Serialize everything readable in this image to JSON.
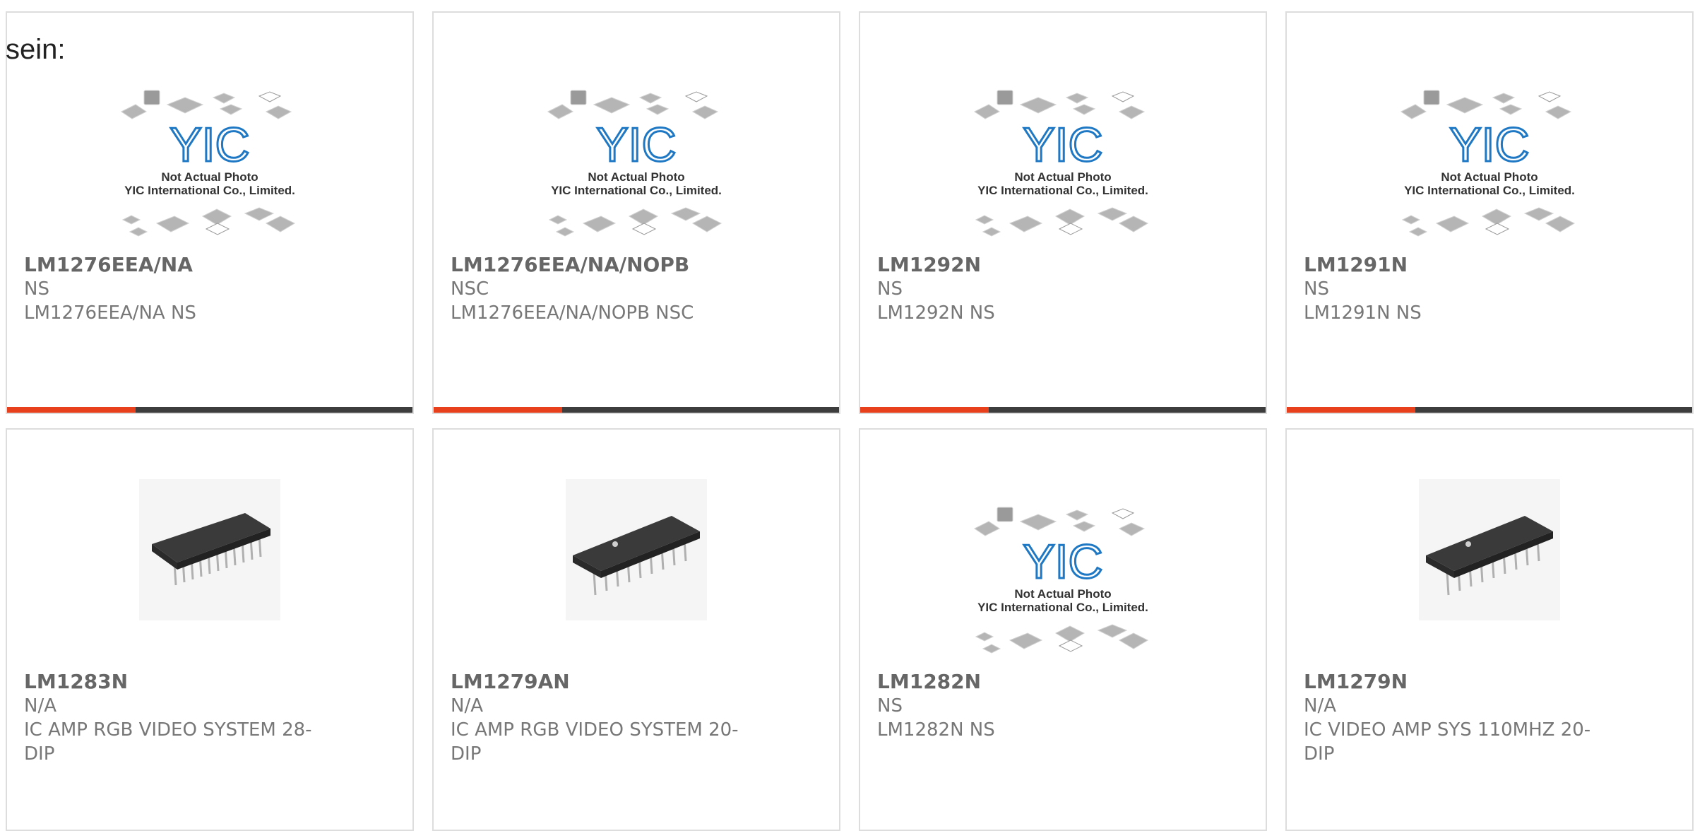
{
  "header": {
    "label": "sein:"
  },
  "placeholder_image": {
    "line1": "Not Actual Photo",
    "line2": "YIC International Co., Limited.",
    "logo_text": "YIC"
  },
  "colors": {
    "accent": "#e8401c",
    "bar": "#3d3d3d",
    "border": "#dddddd",
    "logo_blue": "#1f78c4"
  },
  "products": [
    {
      "part": "LM1276EEA/NA",
      "manufacturer": "NS",
      "description": "LM1276EEA/NA NS",
      "image": "placeholder"
    },
    {
      "part": "LM1276EEA/NA/NOPB",
      "manufacturer": "NSC",
      "description": "LM1276EEA/NA/NOPB NSC",
      "image": "placeholder"
    },
    {
      "part": "LM1292N",
      "manufacturer": "NS",
      "description": "LM1292N NS",
      "image": "placeholder"
    },
    {
      "part": "LM1291N",
      "manufacturer": "NS",
      "description": "LM1291N NS",
      "image": "placeholder"
    },
    {
      "part": "LM1283N",
      "manufacturer": "N/A",
      "description": "IC AMP RGB VIDEO SYSTEM 28-DIP",
      "image": "dip28-chip"
    },
    {
      "part": "LM1279AN",
      "manufacturer": "N/A",
      "description": "IC AMP RGB VIDEO SYSTEM 20-DIP",
      "image": "dip20-chip"
    },
    {
      "part": "LM1282N",
      "manufacturer": "NS",
      "description": "LM1282N NS",
      "image": "placeholder"
    },
    {
      "part": "LM1279N",
      "manufacturer": "N/A",
      "description": "IC VIDEO AMP SYS 110MHZ 20-DIP",
      "image": "dip20-chip"
    }
  ]
}
